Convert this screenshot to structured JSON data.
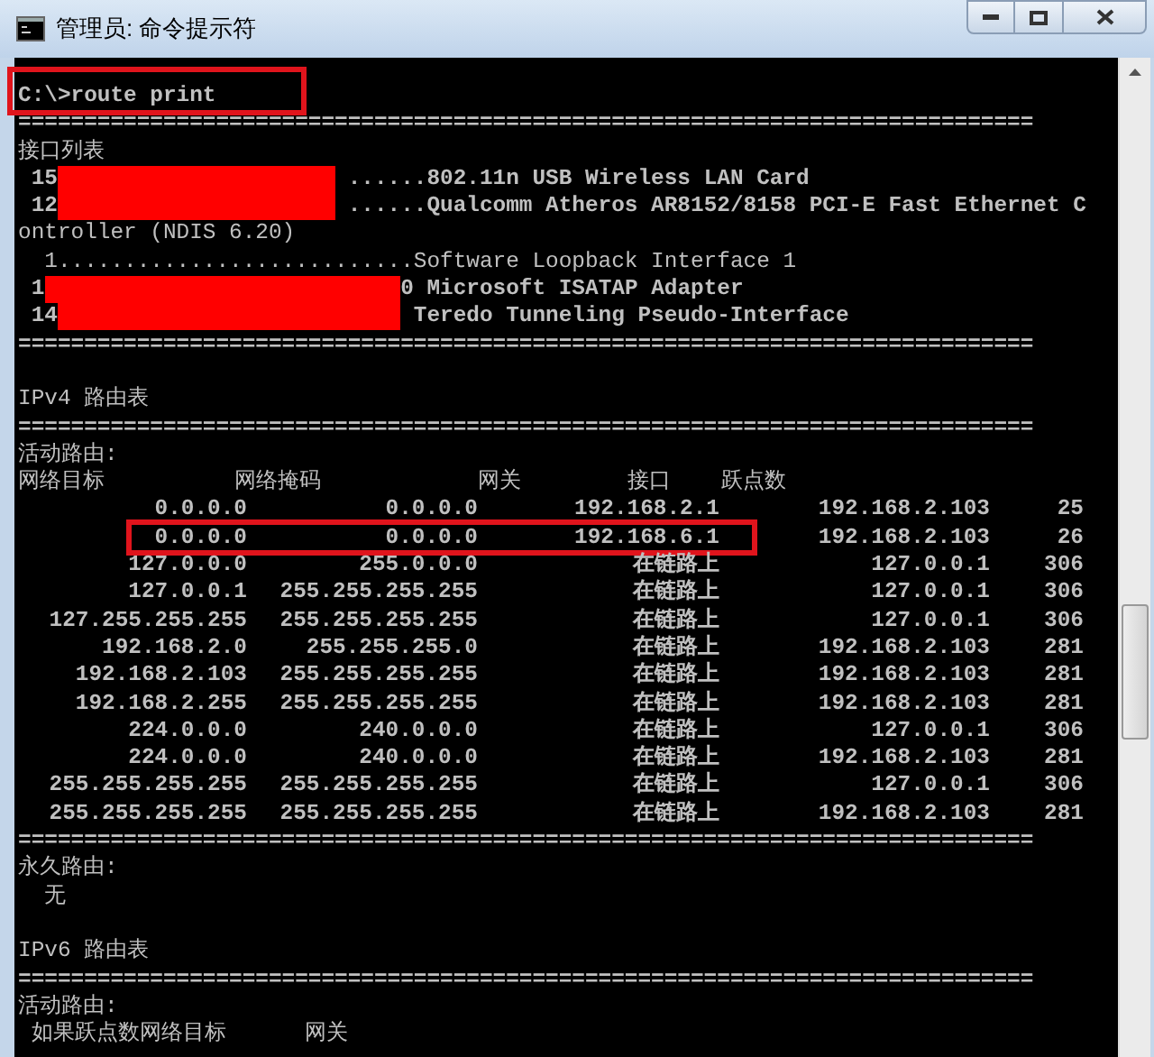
{
  "window": {
    "title": "管理员: 命令提示符"
  },
  "console": {
    "lines": [
      {
        "kind": "command",
        "text": "C:\\>route print",
        "highlighted": true
      },
      {
        "kind": "rule",
        "text": "============================================================================="
      },
      {
        "kind": "text",
        "text": "接口列表"
      },
      {
        "kind": "interface",
        "segments": [
          {
            "kind": "text",
            "text": " 15"
          },
          {
            "kind": "redacted"
          },
          {
            "kind": "text",
            "text": " ......802.11n USB Wireless LAN Card"
          }
        ]
      },
      {
        "kind": "interface",
        "segments": [
          {
            "kind": "text",
            "text": " 12"
          },
          {
            "kind": "redacted"
          },
          {
            "kind": "text",
            "text": " ......Qualcomm Atheros AR8152/8158 PCI-E Fast Ethernet C"
          }
        ]
      },
      {
        "kind": "text",
        "text": "ontroller (NDIS 6.20)"
      },
      {
        "kind": "text",
        "text": "  1...........................Software Loopback Interface 1"
      },
      {
        "kind": "interface",
        "segments": [
          {
            "kind": "text",
            "text": " 1"
          },
          {
            "kind": "redacted"
          },
          {
            "kind": "text",
            "text": "0 Microsoft ISATAP Adapter"
          }
        ]
      },
      {
        "kind": "interface",
        "segments": [
          {
            "kind": "text",
            "text": " 14"
          },
          {
            "kind": "redacted"
          },
          {
            "kind": "text",
            "text": " Teredo Tunneling Pseudo-Interface"
          }
        ]
      },
      {
        "kind": "rule",
        "text": "============================================================================="
      },
      {
        "kind": "blank"
      },
      {
        "kind": "text",
        "text": "IPv4 路由表"
      },
      {
        "kind": "rule",
        "text": "============================================================================="
      },
      {
        "kind": "text",
        "text": "活动路由:"
      },
      {
        "kind": "routes_header",
        "cells": [
          "网络目标",
          "网络掩码",
          "网关",
          "接口",
          "跃点数"
        ]
      },
      {
        "kind": "route",
        "highlighted": false,
        "cells": [
          "0.0.0.0",
          "0.0.0.0",
          "192.168.2.1",
          "192.168.2.103",
          "25"
        ]
      },
      {
        "kind": "route",
        "highlighted": true,
        "cells": [
          "0.0.0.0",
          "0.0.0.0",
          "192.168.6.1",
          "192.168.2.103",
          "26"
        ]
      },
      {
        "kind": "route",
        "highlighted": false,
        "cells": [
          "127.0.0.0",
          "255.0.0.0",
          "在链路上",
          "127.0.0.1",
          "306"
        ]
      },
      {
        "kind": "route",
        "highlighted": false,
        "cells": [
          "127.0.0.1",
          "255.255.255.255",
          "在链路上",
          "127.0.0.1",
          "306"
        ]
      },
      {
        "kind": "route",
        "highlighted": false,
        "cells": [
          "127.255.255.255",
          "255.255.255.255",
          "在链路上",
          "127.0.0.1",
          "306"
        ]
      },
      {
        "kind": "route",
        "highlighted": false,
        "cells": [
          "192.168.2.0",
          "255.255.255.0",
          "在链路上",
          "192.168.2.103",
          "281"
        ]
      },
      {
        "kind": "route",
        "highlighted": false,
        "cells": [
          "192.168.2.103",
          "255.255.255.255",
          "在链路上",
          "192.168.2.103",
          "281"
        ]
      },
      {
        "kind": "route",
        "highlighted": false,
        "cells": [
          "192.168.2.255",
          "255.255.255.255",
          "在链路上",
          "192.168.2.103",
          "281"
        ]
      },
      {
        "kind": "route",
        "highlighted": false,
        "cells": [
          "224.0.0.0",
          "240.0.0.0",
          "在链路上",
          "127.0.0.1",
          "306"
        ]
      },
      {
        "kind": "route",
        "highlighted": false,
        "cells": [
          "224.0.0.0",
          "240.0.0.0",
          "在链路上",
          "192.168.2.103",
          "281"
        ]
      },
      {
        "kind": "route",
        "highlighted": false,
        "cells": [
          "255.255.255.255",
          "255.255.255.255",
          "在链路上",
          "127.0.0.1",
          "306"
        ]
      },
      {
        "kind": "route",
        "highlighted": false,
        "cells": [
          "255.255.255.255",
          "255.255.255.255",
          "在链路上",
          "192.168.2.103",
          "281"
        ]
      },
      {
        "kind": "rule",
        "text": "============================================================================="
      },
      {
        "kind": "text",
        "text": "永久路由:"
      },
      {
        "kind": "text",
        "text": "  无"
      },
      {
        "kind": "blank"
      },
      {
        "kind": "text",
        "text": "IPv6 路由表"
      },
      {
        "kind": "rule",
        "text": "============================================================================="
      },
      {
        "kind": "text",
        "text": "活动路由:"
      },
      {
        "kind": "text",
        "text": " 如果跃点数网络目标      网关"
      }
    ]
  }
}
